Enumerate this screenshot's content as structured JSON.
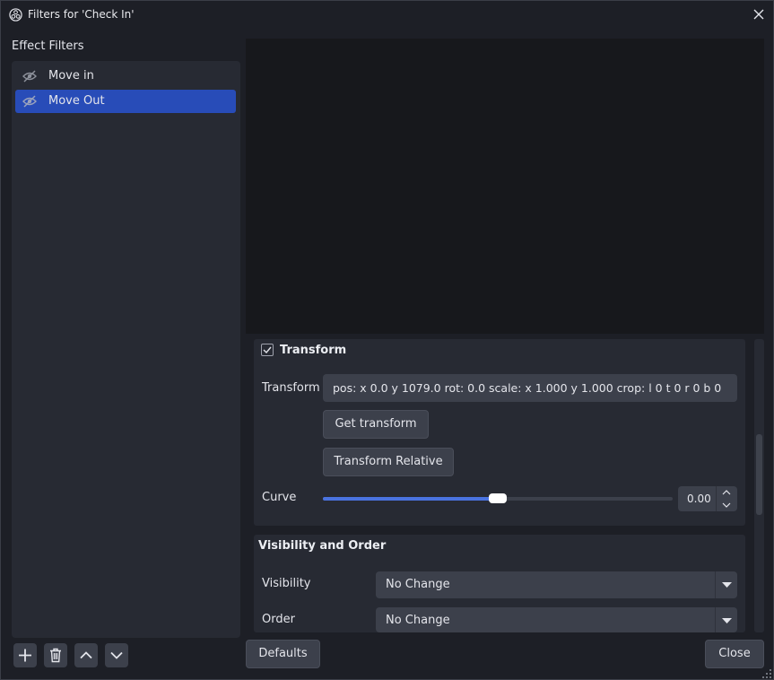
{
  "window": {
    "title": "Filters for 'Check In'"
  },
  "sidebar": {
    "label": "Effect Filters",
    "filters": [
      {
        "label": "Move in",
        "icon": "eye-hidden-icon",
        "selected": false
      },
      {
        "label": "Move Out",
        "icon": "eye-hidden-icon",
        "selected": true
      }
    ],
    "buttons": [
      {
        "name": "add-filter-button",
        "icon": "plus-icon"
      },
      {
        "name": "remove-filter-button",
        "icon": "trash-icon"
      },
      {
        "name": "move-up-button",
        "icon": "chevron-up-icon"
      },
      {
        "name": "move-down-button",
        "icon": "chevron-down-icon"
      }
    ]
  },
  "transform_group": {
    "title": "Transform",
    "enabled": true,
    "transform_label": "Transform",
    "transform_value": "pos: x 0.0 y 1079.0 rot: 0.0 scale: x 1.000 y 1.000 crop: l 0 t 0 r 0 b 0",
    "get_transform_label": "Get transform",
    "transform_relative_label": "Transform Relative",
    "curve_label": "Curve",
    "curve_value": "0.00",
    "curve_slider_fraction": 0.5
  },
  "visibility_group": {
    "title": "Visibility and Order",
    "visibility_label": "Visibility",
    "visibility_value": "No Change",
    "order_label": "Order",
    "order_value": "No Change"
  },
  "footer": {
    "defaults_label": "Defaults",
    "close_label": "Close"
  },
  "colors": {
    "background": "#1d1f26",
    "panel": "#272a33",
    "control": "#3c404b",
    "selection": "#284cb8",
    "accent": "#4a73e0"
  }
}
